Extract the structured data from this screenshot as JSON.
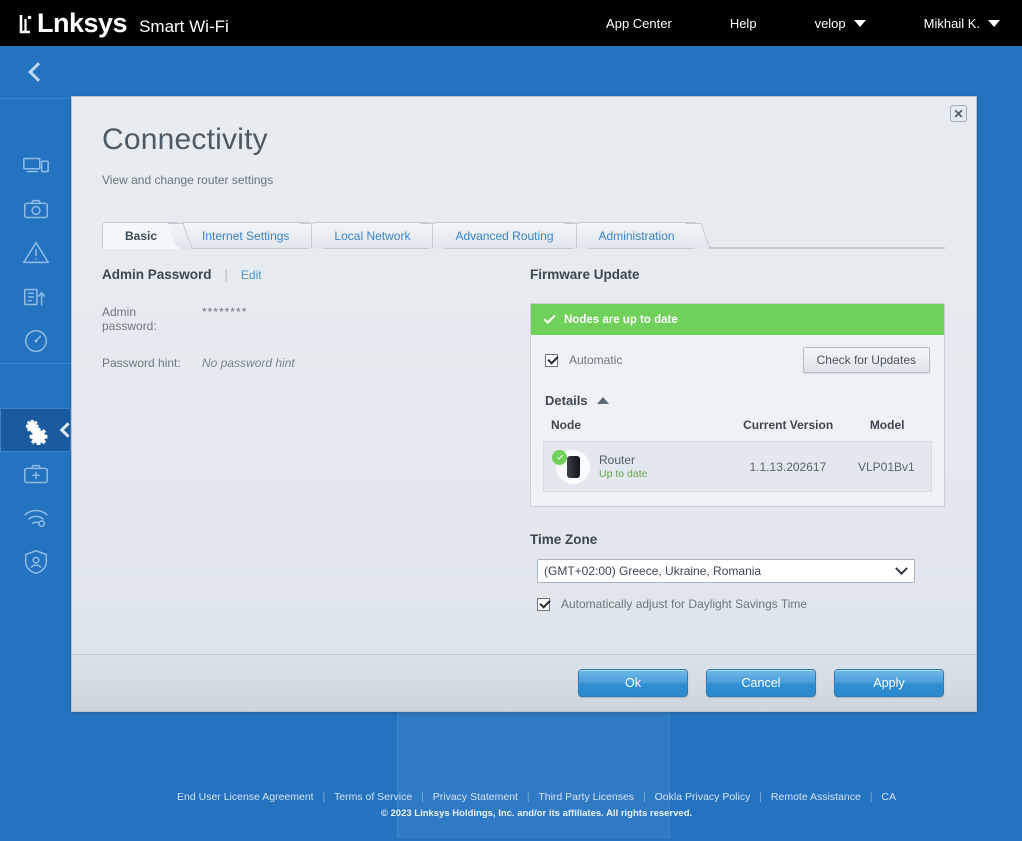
{
  "topbar": {
    "logo": "Lnksys",
    "product": "Smart Wi-Fi",
    "nav": [
      {
        "label": "App Center",
        "caret": false
      },
      {
        "label": "Help",
        "caret": false
      },
      {
        "label": "velop",
        "caret": true
      },
      {
        "label": "Mikhail K.",
        "caret": true
      }
    ]
  },
  "sidebar": {
    "collapse_icon": "chevron-left-icon",
    "groups": [
      {
        "items": [
          {
            "icon": "network-devices-icon",
            "name": "device-list"
          },
          {
            "icon": "guest-access-icon",
            "name": "guest-access"
          },
          {
            "icon": "parental-controls-icon",
            "name": "parental-controls"
          },
          {
            "icon": "media-prioritization-icon",
            "name": "media-prioritization"
          },
          {
            "icon": "speed-test-icon",
            "name": "speed-test"
          }
        ]
      },
      {
        "items": [
          {
            "icon": "gears-icon",
            "name": "connectivity",
            "active": true
          },
          {
            "icon": "troubleshooting-icon",
            "name": "troubleshooting"
          },
          {
            "icon": "wireless-icon",
            "name": "wireless"
          },
          {
            "icon": "security-icon",
            "name": "security"
          }
        ]
      }
    ]
  },
  "dialog": {
    "close_label": "✕",
    "title": "Connectivity",
    "subtitle": "View and change router settings",
    "tabs": [
      {
        "label": "Basic",
        "active": true
      },
      {
        "label": "Internet Settings",
        "active": false
      },
      {
        "label": "Local Network",
        "active": false
      },
      {
        "label": "Advanced Routing",
        "active": false
      },
      {
        "label": "Administration",
        "active": false
      }
    ],
    "admin_password": {
      "section_title": "Admin Password",
      "separator": "|",
      "edit_label": "Edit",
      "password_label": "Admin password:",
      "password_value": "********",
      "hint_label": "Password hint:",
      "hint_value": "No password hint"
    },
    "firmware": {
      "section_title": "Firmware Update",
      "banner_text": "Nodes are up to date",
      "banner_color": "#6fd05a",
      "automatic_label": "Automatic",
      "automatic_checked": true,
      "check_button": "Check for Updates",
      "details_label": "Details",
      "details_expanded": true,
      "columns": [
        "Node",
        "Current Version",
        "Model"
      ],
      "rows": [
        {
          "node_name": "Router",
          "node_state": "Up to date",
          "current_version": "1.1.13.202617",
          "model": "VLP01Bv1",
          "status": "ok"
        }
      ]
    },
    "timezone": {
      "section_title": "Time Zone",
      "selected": "(GMT+02:00) Greece, Ukraine, Romania",
      "dst_label": "Automatically adjust for Daylight Savings Time",
      "dst_checked": true
    },
    "footer_buttons": [
      {
        "label": "Ok",
        "name": "ok-button"
      },
      {
        "label": "Cancel",
        "name": "cancel-button"
      },
      {
        "label": "Apply",
        "name": "apply-button"
      }
    ]
  },
  "page_footer": {
    "links": [
      "End User License Agreement",
      "Terms of Service",
      "Privacy Statement",
      "Third Party Licenses",
      "Ookla Privacy Policy",
      "Remote Assistance",
      "CA"
    ],
    "divider": "|",
    "copyright": "© 2023 Linksys Holdings, Inc. and/or its affiliates. All rights reserved."
  }
}
